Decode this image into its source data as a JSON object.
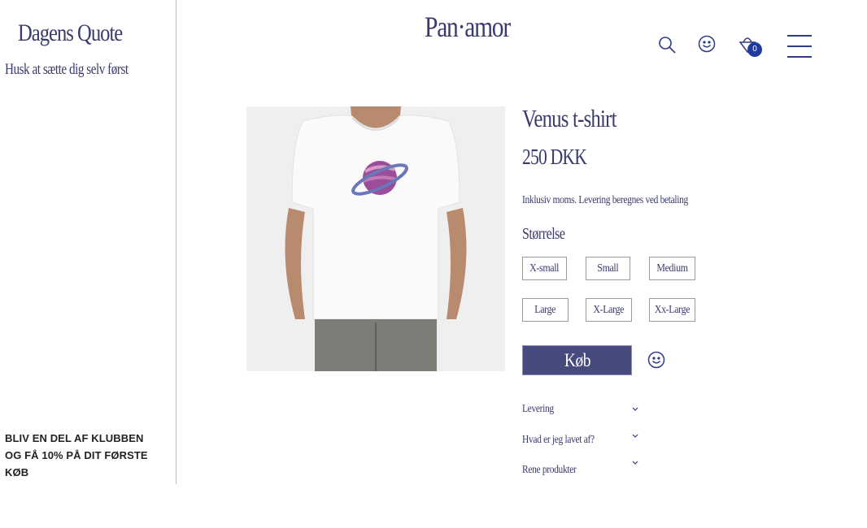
{
  "sidebar": {
    "quote_title": "Dagens Quote",
    "quote_text": "Husk at sætte dig selv først",
    "club_text": "BLIV EN DEL AF KLUBBEN OG FÅ 10% PÅ DIT FØRSTE KØB"
  },
  "header": {
    "logo": "Pan·amor",
    "cart_count": "0",
    "icons": [
      "search-icon",
      "smiley-icon",
      "shopping-bag-icon",
      "hamburger-menu-icon"
    ]
  },
  "product": {
    "name": "Venus t-shirt",
    "price": "250 DKK",
    "vat_note": "Inklusiv moms. Levering beregnes ved betaling",
    "size_label": "Størrelse",
    "sizes": [
      "X-small",
      "Small",
      "Medium",
      "Large",
      "X-Large",
      "Xx-Large"
    ],
    "buy_label": "Køb",
    "accordion": [
      {
        "label": "Levering"
      },
      {
        "label": "Hvad er jeg lavet af?"
      },
      {
        "label": "Rene produkter"
      }
    ]
  },
  "colors": {
    "brand": "#3a3a6c",
    "button": "#474a7c",
    "icon": "#2e3a86",
    "badge": "#1f3a9a"
  }
}
